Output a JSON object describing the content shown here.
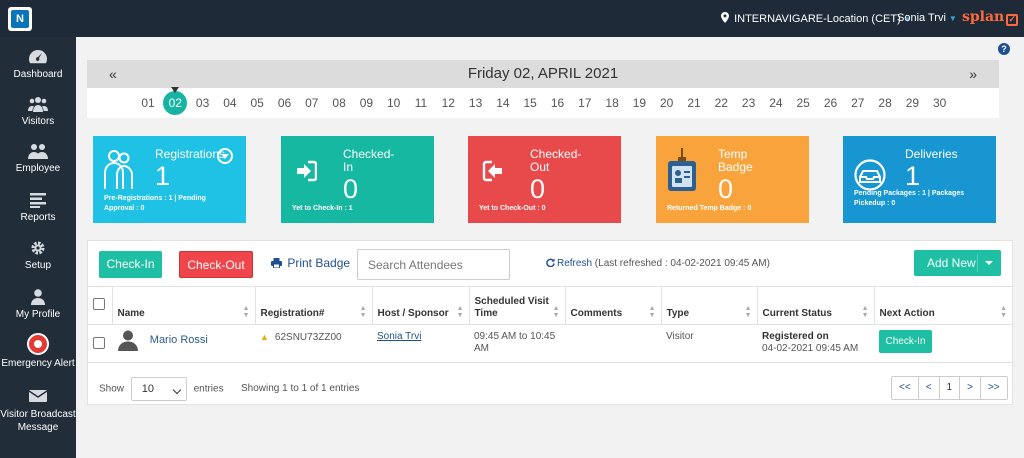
{
  "topbar": {
    "logo": "N",
    "location": "INTERNAVIGARE-Location (CET)",
    "user": "Sonia Trvi",
    "brand": "splan"
  },
  "sidebar": {
    "items": [
      {
        "label": "Dashboard",
        "icon": "dashboard-icon"
      },
      {
        "label": "Visitors",
        "icon": "visitors-icon"
      },
      {
        "label": "Employee",
        "icon": "employee-icon"
      },
      {
        "label": "Reports",
        "icon": "reports-icon"
      },
      {
        "label": "Setup",
        "icon": "gear-icon"
      },
      {
        "label": "My Profile",
        "icon": "user-icon"
      },
      {
        "label": "Emergency Alert",
        "icon": "alarm-icon"
      },
      {
        "label": "Visitor Broadcast Message",
        "icon": "envelope-icon"
      }
    ]
  },
  "datebar": {
    "prev": "«",
    "next": "»",
    "title": "Friday 02, APRIL 2021",
    "days": [
      "01",
      "02",
      "03",
      "04",
      "05",
      "06",
      "07",
      "08",
      "09",
      "10",
      "11",
      "12",
      "13",
      "14",
      "15",
      "16",
      "17",
      "18",
      "19",
      "20",
      "21",
      "22",
      "23",
      "24",
      "25",
      "26",
      "27",
      "28",
      "29",
      "30"
    ],
    "active_day": "02"
  },
  "cards": {
    "registrations": {
      "title": "Registrations",
      "count": "1",
      "sub1": "Pre-Registrations : 1 | Pending",
      "sub2": "Approval : 0"
    },
    "checked_in": {
      "title1": "Checked-",
      "title2": "In",
      "count": "0",
      "sub": "Yet to Check-In : 1"
    },
    "checked_out": {
      "title1": "Checked-",
      "title2": "Out",
      "count": "0",
      "sub": "Yet to Check-Out : 0"
    },
    "temp_badge": {
      "title1": "Temp",
      "title2": "Badge",
      "count": "0",
      "sub": "Returned Temp Badge : 0"
    },
    "deliveries": {
      "title": "Deliveries",
      "count": "1",
      "sub1": "Pending Packages : 1 | Packages",
      "sub2": "Pickedup : 0"
    }
  },
  "toolbar": {
    "checkin_label": "Check-In",
    "checkout_label": "Check-Out",
    "print_label": "Print Badge",
    "search_placeholder": "Search Attendees",
    "refresh_label": "Refresh",
    "refresh_info": "(Last refreshed : 04-02-2021 09:45 AM)",
    "add_new_label": "Add New"
  },
  "table": {
    "headers": [
      "Name",
      "Registration#",
      "Host / Sponsor",
      "Scheduled Visit Time",
      "Comments",
      "Type",
      "Current Status",
      "Next Action"
    ],
    "rows": [
      {
        "name": "Mario Rossi",
        "registration": "62SNU73ZZ00",
        "host": "Sonia Trvi",
        "time": "09:45 AM to 10:45 AM",
        "comments": "",
        "type": "Visitor",
        "status_line1": "Registered on",
        "status_line2": "04-02-2021 09:45 AM",
        "action": "Check-In"
      }
    ]
  },
  "footer": {
    "show_label": "Show",
    "entries_value": "10",
    "entries_label": "entries",
    "info": "Showing 1 to 1 of 1 entries",
    "pager": [
      "<<",
      "<",
      "1",
      ">",
      ">>"
    ]
  }
}
